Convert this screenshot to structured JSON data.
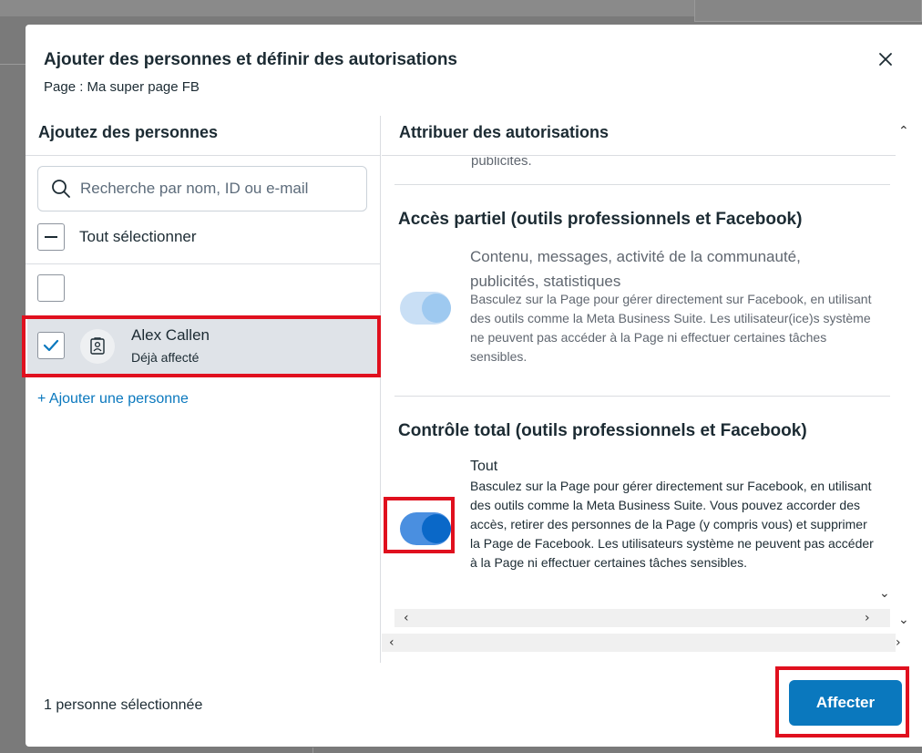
{
  "dialog": {
    "title": "Ajouter des personnes et définir des autorisations",
    "subtitle": "Page : Ma super page FB"
  },
  "left_panel": {
    "heading": "Ajoutez des personnes",
    "search_placeholder": "Recherche par nom, ID ou e-mail",
    "select_all_label": "Tout sélectionner",
    "people": [
      {
        "name": "Alex Callen",
        "status": "Déjà affecté",
        "checked": true
      }
    ],
    "add_person_label": "+ Ajouter une personne"
  },
  "right_panel": {
    "heading": "Attribuer des autorisations",
    "truncated_text": "publicités.",
    "sections": [
      {
        "title": "Accès partiel (outils professionnels et Facebook)",
        "summary": "Contenu, messages, activité de la communauté, publicités, statistiques",
        "description": "Basculez sur la Page pour gérer directement sur Facebook, en utilisant des outils comme la Meta Business Suite. Les utilisateur(ice)s système ne peuvent pas accéder à la Page ni effectuer certaines tâches sensibles.",
        "toggle_on": false
      },
      {
        "title": "Contrôle total (outils professionnels et Facebook)",
        "summary": "Tout",
        "description": "Basculez sur la Page pour gérer directement sur Facebook, en utilisant des outils comme la Meta Business Suite. Vous pouvez accorder des accès, retirer des personnes de la Page (y compris vous) et supprimer la Page de Facebook. Les utilisateurs système ne peuvent pas accéder à la Page ni effectuer certaines tâches sensibles.",
        "toggle_on": true
      }
    ]
  },
  "footer": {
    "selection_count": "1 personne sélectionnée",
    "submit_label": "Affecter"
  },
  "colors": {
    "primary": "#0a78be",
    "highlight": "#e0101e",
    "selected_row": "#dfe3e8"
  }
}
